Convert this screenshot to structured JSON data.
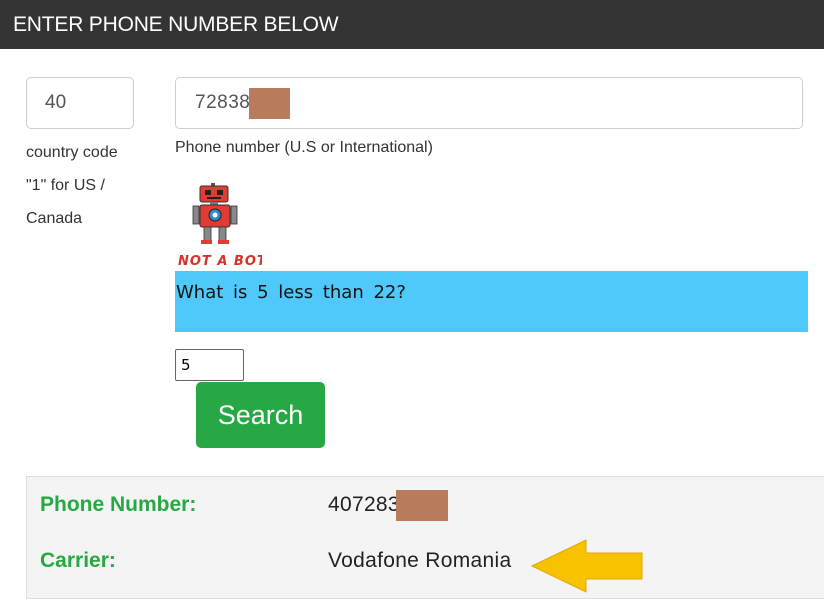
{
  "header": {
    "title": "ENTER PHONE NUMBER BELOW"
  },
  "form": {
    "country_code_value": "40",
    "country_code_help": [
      "country code",
      "\"1\" for US /",
      "Canada"
    ],
    "phone_value": "72838 56",
    "phone_help": "Phone number (U.S or International)",
    "captcha_logo_text": "NOT A BOT",
    "captcha_question": "What is 5 less than 22?",
    "captcha_answer": "5",
    "search_label": "Search"
  },
  "results": {
    "phone_label": "Phone Number:",
    "phone_value": "407283 56",
    "carrier_label": "Carrier:",
    "carrier_value": "Vodafone Romania"
  },
  "colors": {
    "header_bg": "#343434",
    "question_bg": "#4fc8fb",
    "accent_green": "#28a745",
    "redaction": "#b87b5c",
    "arrow": "#f7c300"
  },
  "icons": {
    "captcha": "robot-icon",
    "pointer": "arrow-left-icon"
  }
}
